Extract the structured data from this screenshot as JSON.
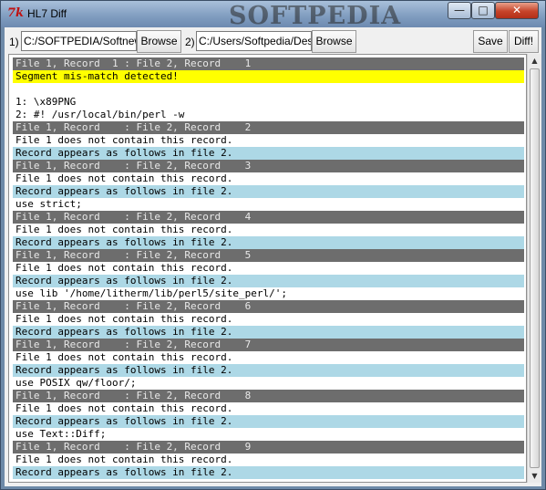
{
  "window": {
    "title": "HL7 Diff",
    "watermark": "SOFTPEDIA",
    "buttons": {
      "minimize": "—",
      "maximize": "□",
      "close": "✕"
    }
  },
  "toolbar": {
    "label1": "1)",
    "path1": "C:/SOFTPEDIA/Softnews",
    "browse1": "Browse",
    "label2": "2)",
    "path2": "C:/Users/Softpedia/Desk",
    "browse2": "Browse",
    "save": "Save",
    "diff": "Diff!"
  },
  "lines": [
    {
      "style": "hdr",
      "text": "File 1, Record  1 : File 2, Record    1"
    },
    {
      "style": "warn",
      "text": "Segment mis-match detected!"
    },
    {
      "style": "plain",
      "text": ""
    },
    {
      "style": "plain",
      "text": "1: \\x89PNG"
    },
    {
      "style": "plain",
      "text": "2: #! /usr/local/bin/perl -w"
    },
    {
      "style": "hdr",
      "text": "File 1, Record    : File 2, Record    2"
    },
    {
      "style": "plain",
      "text": "File 1 does not contain this record."
    },
    {
      "style": "blue",
      "text": "Record appears as follows in file 2."
    },
    {
      "style": "hdr",
      "text": "File 1, Record    : File 2, Record    3"
    },
    {
      "style": "plain",
      "text": "File 1 does not contain this record."
    },
    {
      "style": "blue",
      "text": "Record appears as follows in file 2."
    },
    {
      "style": "plain",
      "text": "use strict;"
    },
    {
      "style": "hdr",
      "text": "File 1, Record    : File 2, Record    4"
    },
    {
      "style": "plain",
      "text": "File 1 does not contain this record."
    },
    {
      "style": "blue",
      "text": "Record appears as follows in file 2."
    },
    {
      "style": "hdr",
      "text": "File 1, Record    : File 2, Record    5"
    },
    {
      "style": "plain",
      "text": "File 1 does not contain this record."
    },
    {
      "style": "blue",
      "text": "Record appears as follows in file 2."
    },
    {
      "style": "plain",
      "text": "use lib '/home/litherm/lib/perl5/site_perl/';"
    },
    {
      "style": "hdr",
      "text": "File 1, Record    : File 2, Record    6"
    },
    {
      "style": "plain",
      "text": "File 1 does not contain this record."
    },
    {
      "style": "blue",
      "text": "Record appears as follows in file 2."
    },
    {
      "style": "hdr",
      "text": "File 1, Record    : File 2, Record    7"
    },
    {
      "style": "plain",
      "text": "File 1 does not contain this record."
    },
    {
      "style": "blue",
      "text": "Record appears as follows in file 2."
    },
    {
      "style": "plain",
      "text": "use POSIX qw/floor/;"
    },
    {
      "style": "hdr",
      "text": "File 1, Record    : File 2, Record    8"
    },
    {
      "style": "plain",
      "text": "File 1 does not contain this record."
    },
    {
      "style": "blue",
      "text": "Record appears as follows in file 2."
    },
    {
      "style": "plain",
      "text": "use Text::Diff;"
    },
    {
      "style": "hdr",
      "text": "File 1, Record    : File 2, Record    9"
    },
    {
      "style": "plain",
      "text": "File 1 does not contain this record."
    },
    {
      "style": "blue",
      "text": "Record appears as follows in file 2."
    }
  ],
  "scrollbar": {
    "up": "▲",
    "down": "▼"
  }
}
